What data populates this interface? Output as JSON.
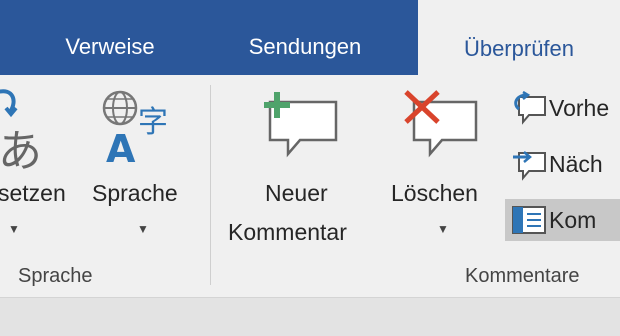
{
  "tabs": {
    "verweise": "Verweise",
    "sendungen": "Sendungen",
    "ueberpruefen": "Überprüfen"
  },
  "sprache_group": {
    "uebersetzen_label": "setzen",
    "sprache_label": "Sprache",
    "group_label": "Sprache",
    "sprache_icon_text": "字"
  },
  "kommentare_group": {
    "neuer_line1": "Neuer",
    "neuer_line2": "Kommentar",
    "loeschen_label": "Löschen",
    "vorheriger_label": "Vorhe",
    "naechster_label": "Näch",
    "kommentare_anzeigen_label": "Kom",
    "group_label": "Kommentare"
  },
  "colors": {
    "brand": "#2b579a",
    "accent_green": "#4fa36b",
    "accent_red": "#d9442c",
    "icon_blue": "#2e75b6"
  }
}
